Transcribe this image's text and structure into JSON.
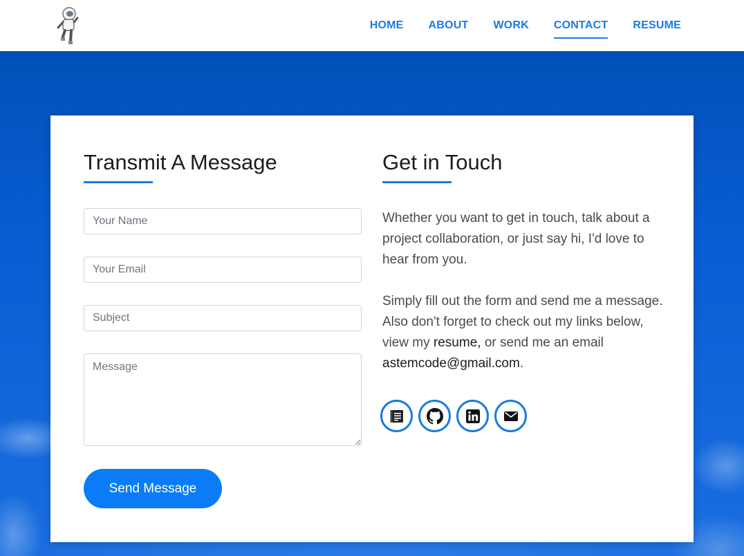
{
  "nav": {
    "items": [
      {
        "label": "HOME",
        "active": false
      },
      {
        "label": "ABOUT",
        "active": false
      },
      {
        "label": "WORK",
        "active": false
      },
      {
        "label": "CONTACT",
        "active": true
      },
      {
        "label": "RESUME",
        "active": false
      }
    ]
  },
  "form": {
    "title": "Transmit A Message",
    "name_placeholder": "Your Name",
    "email_placeholder": "Your Email",
    "subject_placeholder": "Subject",
    "message_placeholder": "Message",
    "send_label": "Send Message"
  },
  "contact": {
    "title": "Get in Touch",
    "para1": "Whether you want to get in touch, talk about a project collaboration, or just say hi, I'd love to hear from you.",
    "para2_a": "Simply fill out the form and send me a message. Also don't forget to check out my links below, view my ",
    "resume_link": "resume,",
    "para2_b": " or send me an email ",
    "email_link": "astemcode@gmail.com",
    "para2_c": ".",
    "social_icons": [
      "resume-icon",
      "github-icon",
      "linkedin-icon",
      "mail-icon"
    ]
  },
  "colors": {
    "accent": "#1a7be0",
    "button": "#0b7cf7",
    "background": "#0a5bd1"
  }
}
